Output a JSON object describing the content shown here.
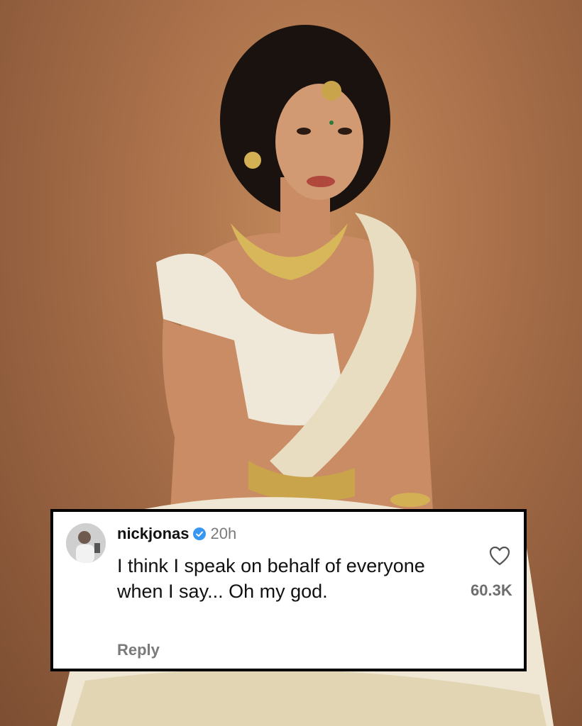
{
  "photo": {
    "description_icon": "portrait-photo",
    "background_color": "#a9704a"
  },
  "comment": {
    "username": "nickjonas",
    "verified_icon": "verified-badge-icon",
    "time": "20h",
    "text": "I think I speak on behalf of everyone when I say... Oh my god.",
    "reply_label": "Reply",
    "like_icon": "heart-icon",
    "like_count": "60.3K",
    "accent": "#3897f0"
  }
}
